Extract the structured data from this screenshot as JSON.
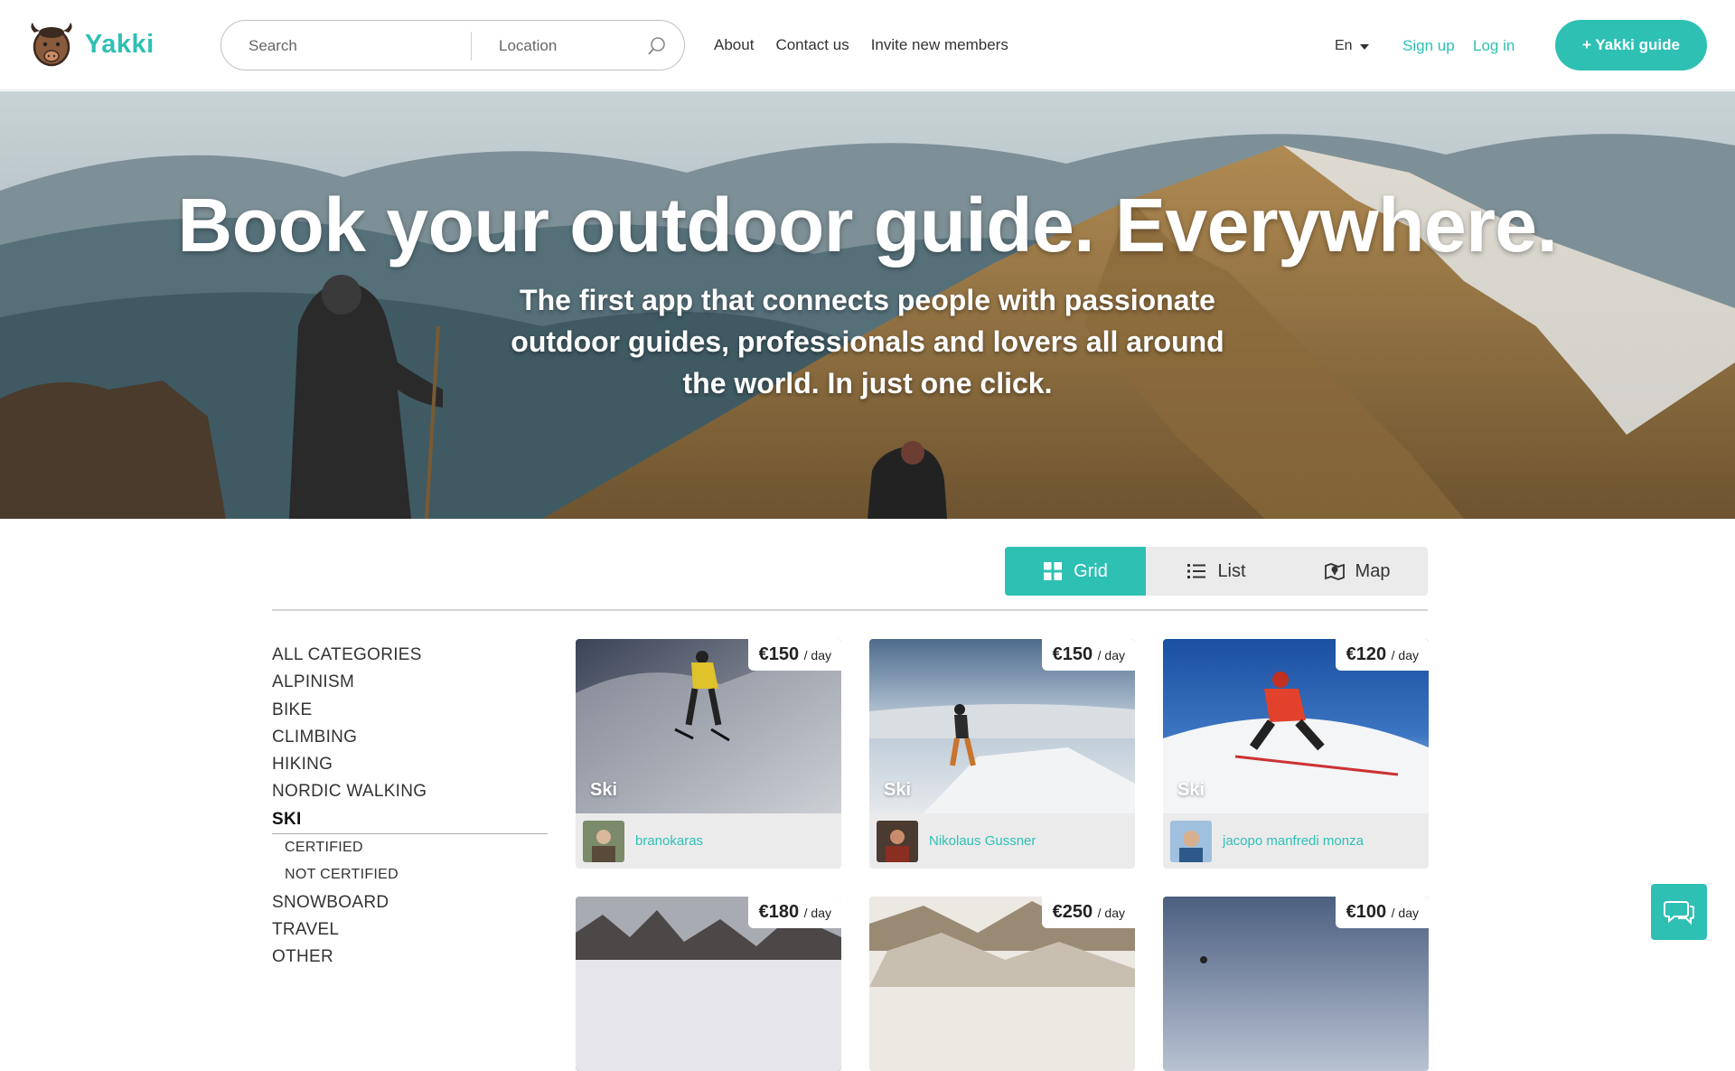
{
  "brand": {
    "name": "Yakki",
    "accent": "#2fc0b4"
  },
  "header": {
    "search_placeholder": "Search",
    "location_placeholder": "Location",
    "nav": [
      "About",
      "Contact us",
      "Invite new members"
    ],
    "language": "En",
    "signup": "Sign up",
    "login": "Log in",
    "guide_button": "+ Yakki guide"
  },
  "hero": {
    "title": "Book your outdoor guide. Everywhere.",
    "subtitle": "The first app that connects people with passionate outdoor guides, professionals and lovers all around the world. In just one click."
  },
  "view_toggle": {
    "options": [
      {
        "label": "Grid",
        "icon": "grid-icon",
        "active": true
      },
      {
        "label": "List",
        "icon": "list-icon",
        "active": false
      },
      {
        "label": "Map",
        "icon": "map-icon",
        "active": false
      }
    ]
  },
  "sidebar": {
    "categories": [
      {
        "label": "ALL CATEGORIES"
      },
      {
        "label": "ALPINISM"
      },
      {
        "label": "BIKE"
      },
      {
        "label": "CLIMBING"
      },
      {
        "label": "HIKING"
      },
      {
        "label": "NORDIC WALKING"
      },
      {
        "label": "SKI",
        "active": true
      },
      {
        "label": "CERTIFIED",
        "sub": true
      },
      {
        "label": "NOT CERTIFIED",
        "sub": true
      },
      {
        "label": "SNOWBOARD"
      },
      {
        "label": "TRAVEL"
      },
      {
        "label": "OTHER"
      }
    ]
  },
  "listings": [
    {
      "price": "€150",
      "unit": "/ day",
      "category": "Ski",
      "owner": "branokaras"
    },
    {
      "price": "€150",
      "unit": "/ day",
      "category": "Ski",
      "owner": "Nikolaus Gussner"
    },
    {
      "price": "€120",
      "unit": "/ day",
      "category": "Ski",
      "owner": "jacopo manfredi monza"
    },
    {
      "price": "€180",
      "unit": "/ day",
      "category": "",
      "owner": ""
    },
    {
      "price": "€250",
      "unit": "/ day",
      "category": "",
      "owner": ""
    },
    {
      "price": "€100",
      "unit": "/ day",
      "category": "",
      "owner": ""
    }
  ],
  "chat": {
    "icon": "chat-icon"
  }
}
